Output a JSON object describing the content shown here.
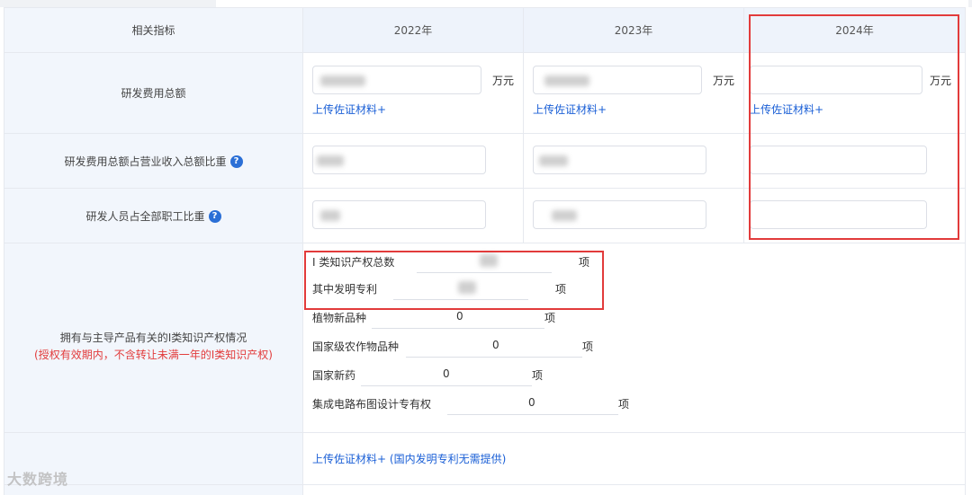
{
  "table": {
    "header": {
      "label": "相关指标",
      "years": [
        "2022年",
        "2023年",
        "2024年"
      ]
    },
    "rd_total": {
      "label": "研发费用总额",
      "unit": "万元",
      "upload": "上传佐证材料+"
    },
    "rd_ratio_revenue": {
      "label": "研发费用总额占营业收入总额比重",
      "help": "?"
    },
    "rd_staff_ratio": {
      "label": "研发人员占全部职工比重",
      "help": "?"
    },
    "ip": {
      "label_line1": "拥有与主导产品有关的I类知识产权情况",
      "label_line2": "(授权有效期内，不含转让未满一年的I类知识产权)",
      "items": [
        {
          "label": "I 类知识产权总数",
          "value": "",
          "unit": "项"
        },
        {
          "label": "其中发明专利",
          "value": "",
          "unit": "项"
        },
        {
          "label": "植物新品种",
          "value": "0",
          "unit": "项"
        },
        {
          "label": "国家级农作物品种",
          "value": "0",
          "unit": "项"
        },
        {
          "label": "国家新药",
          "value": "0",
          "unit": "项"
        },
        {
          "label": "集成电路布图设计专有权",
          "value": "0",
          "unit": "项"
        }
      ],
      "upload": "上传佐证材料+",
      "upload_note": "(国内发明专利无需提供)"
    }
  },
  "watermark": "大数跨境",
  "colors": {
    "accent_link": "#1a5fd6",
    "highlight_box": "#e23b3b",
    "label_bg": "#f2f6fc"
  }
}
